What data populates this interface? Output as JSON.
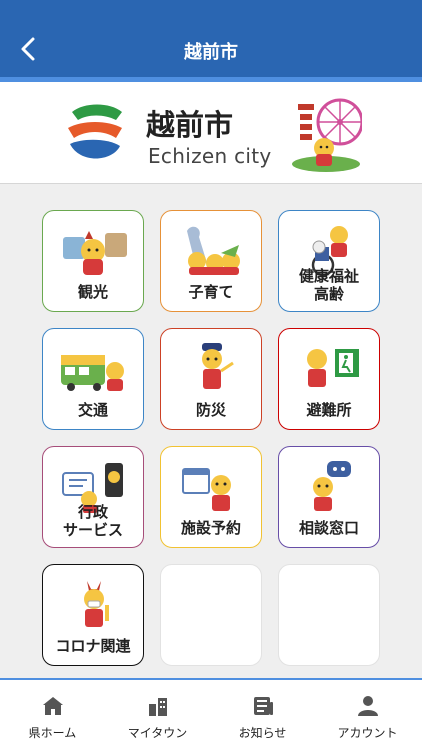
{
  "header": {
    "title": "越前市"
  },
  "banner": {
    "name": "越前市",
    "subtitle": "Echizen city"
  },
  "tiles": [
    {
      "label": "観光",
      "color": "#6aa84f"
    },
    {
      "label": "子育て",
      "color": "#e69138"
    },
    {
      "label": "健康福祉\n高齢",
      "color": "#3d85c6"
    },
    {
      "label": "交通",
      "color": "#3d85c6"
    },
    {
      "label": "防災",
      "color": "#cc4125"
    },
    {
      "label": "避難所",
      "color": "#cc0000"
    },
    {
      "label": "行政\nサービス",
      "color": "#a64d79"
    },
    {
      "label": "施設予約",
      "color": "#f1c232"
    },
    {
      "label": "相談窓口",
      "color": "#674ea7"
    },
    {
      "label": "コロナ関連",
      "color": "#111111"
    }
  ],
  "nav": [
    {
      "label": "県ホーム",
      "icon": "home-icon"
    },
    {
      "label": "マイタウン",
      "icon": "town-icon"
    },
    {
      "label": "お知らせ",
      "icon": "news-icon"
    },
    {
      "label": "アカウント",
      "icon": "account-icon"
    }
  ]
}
